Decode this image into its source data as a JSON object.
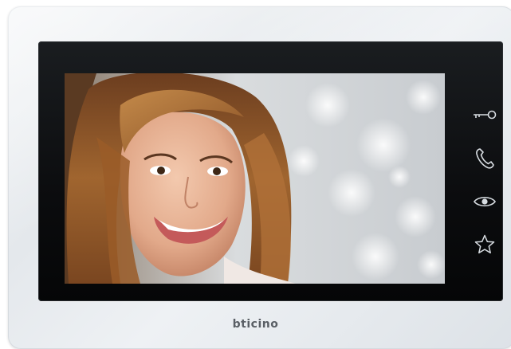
{
  "device": {
    "brand": "bticino",
    "screen_content": "video-feed-visitor-face"
  },
  "controls": [
    {
      "name": "door-lock-key-icon",
      "action": "open-door"
    },
    {
      "name": "phone-handset-icon",
      "action": "answer-call"
    },
    {
      "name": "eye-icon",
      "action": "view-camera"
    },
    {
      "name": "star-icon",
      "action": "favorites"
    }
  ],
  "colors": {
    "bezel": "#0b0c0e",
    "body": "#e8ecef",
    "icon": "#d8dde2",
    "brand_text": "#5a5f65"
  }
}
